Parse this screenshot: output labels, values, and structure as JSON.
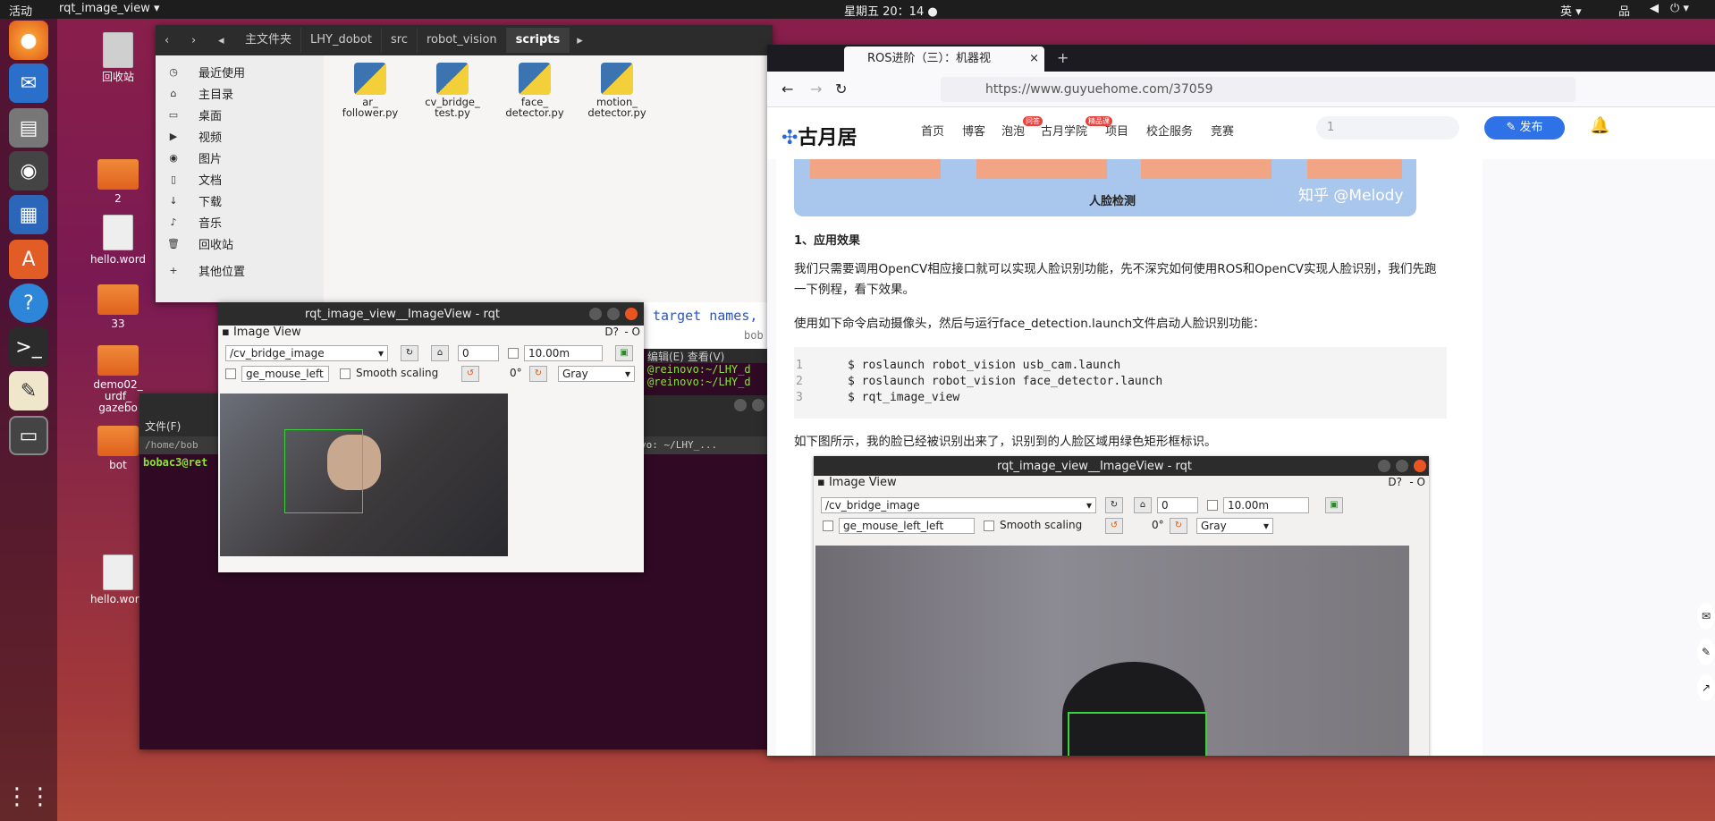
{
  "topbar": {
    "activities": "活动",
    "app": "rqt_image_view ▾",
    "clock": "星期五 20：14 ●",
    "ime": "英 ▾",
    "net": "品",
    "vol": "◀",
    "power": "⏻ ▾"
  },
  "desktop": {
    "trash": "回收站",
    "folder2": "2",
    "hello1": "hello.word",
    "folder33": "33",
    "demo": "demo02_\nurdf_\ngazebo",
    "bot": "bot",
    "hello2": "hello.word"
  },
  "fm": {
    "crumbs": [
      "主文件夹",
      "LHY_dobot",
      "src",
      "robot_vision",
      "scripts"
    ],
    "side": [
      {
        "icon": "◷",
        "label": "最近使用"
      },
      {
        "icon": "⌂",
        "label": "主目录"
      },
      {
        "icon": "▭",
        "label": "桌面"
      },
      {
        "icon": "▶",
        "label": "视频"
      },
      {
        "icon": "◉",
        "label": "图片"
      },
      {
        "icon": "▯",
        "label": "文档"
      },
      {
        "icon": "↓",
        "label": "下载"
      },
      {
        "icon": "♪",
        "label": "音乐"
      },
      {
        "icon": "🗑",
        "label": "回收站"
      },
      {
        "icon": "+",
        "label": "其他位置"
      }
    ],
    "files": [
      "ar_\nfollower.py",
      "cv_bridge_\ntest.py",
      "face_\ndetector.py",
      "motion_\ndetector.py"
    ]
  },
  "terminal": {
    "menu": [
      "文件(F)",
      "编辑(E)",
      "查看(V)"
    ],
    "path": "/home/bob",
    "tab": "vo: ~/LHY_...",
    "prompt": "bobac3@ret",
    "line1": "target names,",
    "line2": "bob",
    "line3": "@reinovo:~/LHY_d",
    "line4": "@reinovo:~/LHY_d"
  },
  "rqt": {
    "title": "rqt_image_view__ImageView - rqt",
    "panel": "Image View",
    "topic": "/cv_bridge_image",
    "num": "0",
    "timeout": "10.00m",
    "mouse": "ge_mouse_left",
    "smooth": "Smooth scaling",
    "deg": "0°",
    "color": "Gray",
    "dq": "D?",
    "dash": "- O"
  },
  "browser": {
    "tab": "ROS进阶（三）：机器视",
    "url": "https://www.guyuehome.com/37059",
    "logo": "古月居",
    "nav": [
      "首页",
      "博客",
      "泡泡",
      "古月学院",
      "项目",
      "校企服务",
      "竞赛"
    ],
    "badge1": "问答",
    "badge2": "精品课",
    "search": "1",
    "publish": "发布",
    "banner": "人脸检测",
    "watermark": "知乎 @Melody",
    "h1": "1、应用效果",
    "p1": "我们只需要调用OpenCV相应接口就可以实现人脸识别功能，先不深究如何使用ROS和OpenCV实现人脸识别，我们先跑一下例程，看下效果。",
    "p2": "使用如下命令启动摄像头，然后与运行face_detection.launch文件启动人脸识别功能：",
    "code": [
      {
        "n": "1",
        "t": "$ roslaunch robot_vision usb_cam.launch"
      },
      {
        "n": "2",
        "t": "$ roslaunch robot_vision face_detector.launch"
      },
      {
        "n": "3",
        "t": "$ rqt_image_view"
      }
    ],
    "p3": "如下图所示，我的脸已经被识别出来了，识别到的人脸区域用绿色矩形框标识。"
  }
}
